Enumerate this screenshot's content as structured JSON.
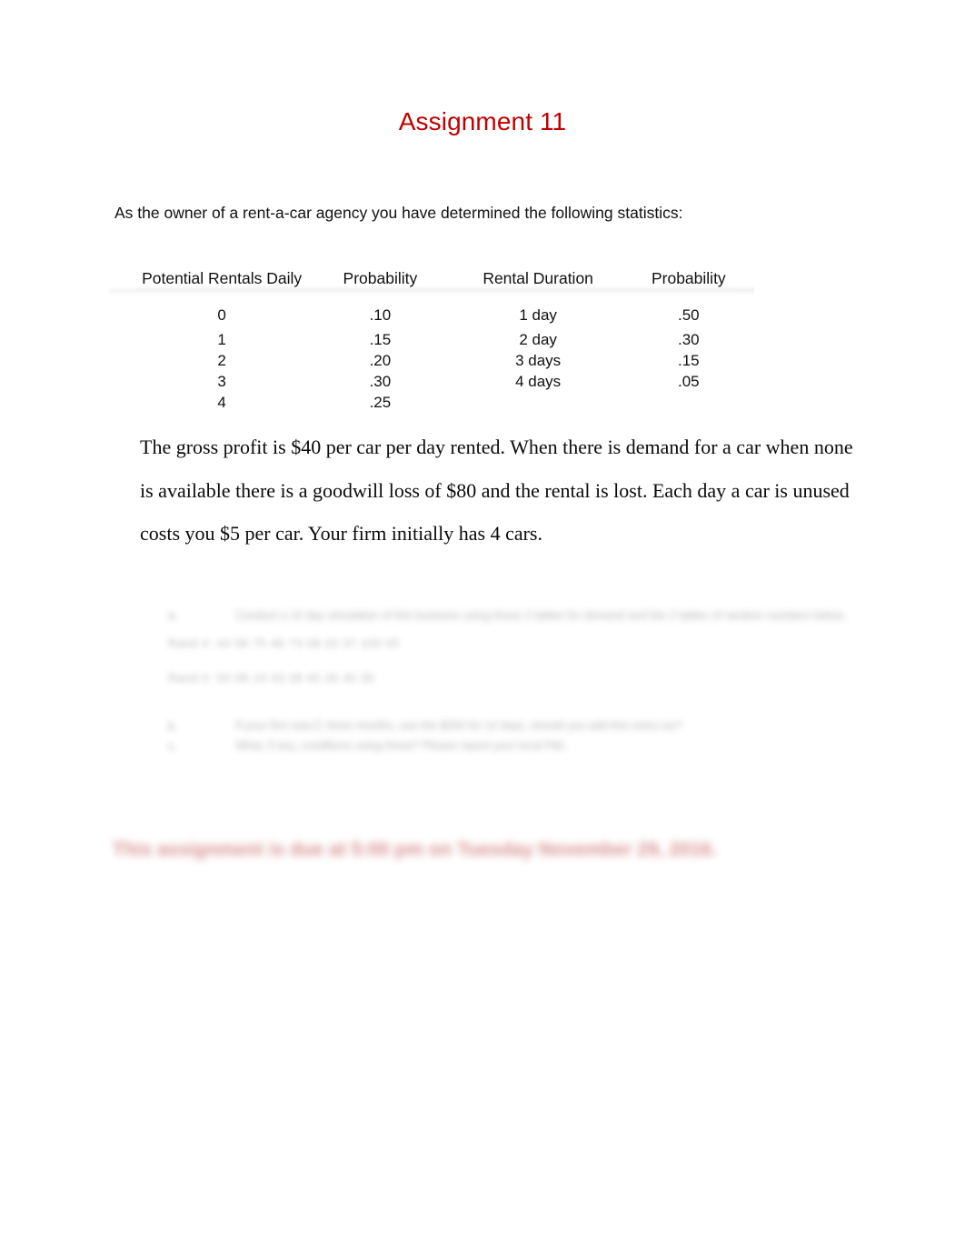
{
  "document": {
    "title": "Assignment 11",
    "title_color": "#C00000",
    "background_color": "#FFFFFF",
    "intro_line": "As the owner of a rent-a-car agency you have determined the following statistics:"
  },
  "stats_table": {
    "headers": [
      "Potential Rentals Daily",
      "Probability",
      "Rental Duration",
      "Probability"
    ],
    "rows": [
      {
        "rentals": "0",
        "rentals_probability": ".10",
        "duration": "1 day",
        "duration_probability": ".50"
      },
      {
        "rentals": "1",
        "rentals_probability": ".15",
        "duration": "2 day",
        "duration_probability": ".30"
      },
      {
        "rentals": "2",
        "rentals_probability": ".20",
        "duration": "3 days",
        "duration_probability": ".15"
      },
      {
        "rentals": "3",
        "rentals_probability": ".30",
        "duration": "4 days",
        "duration_probability": ".05"
      },
      {
        "rentals": "4",
        "rentals_probability": ".25",
        "duration": "",
        "duration_probability": ""
      }
    ]
  },
  "body": {
    "paragraph": "The gross profit is $40 per car per day rented.  When there is demand for a car when none is available there is a goodwill loss of $80 and the rental is lost.  Each day a car is unused costs you $5 per car.  Your firm initially has 4 cars."
  },
  "questions": {
    "item_a_marker": "a.",
    "item_a_text": "Conduct a 10 day simulation of this business using these 2 tables for demand and the 2 tables of random numbers below.",
    "item_a_numbers_1": "Rand #: 44 06 75 46 73 08 24 37 100 05",
    "item_a_numbers_2": "Rand #: 50 08 19 43 28 45 26 40 35",
    "item_b_marker": "b.",
    "item_b_text": "If your firm was三 three months, use the $200 for 10 days, should you add this extra car?",
    "item_c_marker": "c.",
    "item_c_text": "What, if any, conditions using these? Please report your local P&L",
    "blurred": true
  },
  "due_notice": {
    "text": "This assignment is due at 5:00 pm on Tuesday November 29, 2016.",
    "color": "#C0504D",
    "blurred": true
  }
}
